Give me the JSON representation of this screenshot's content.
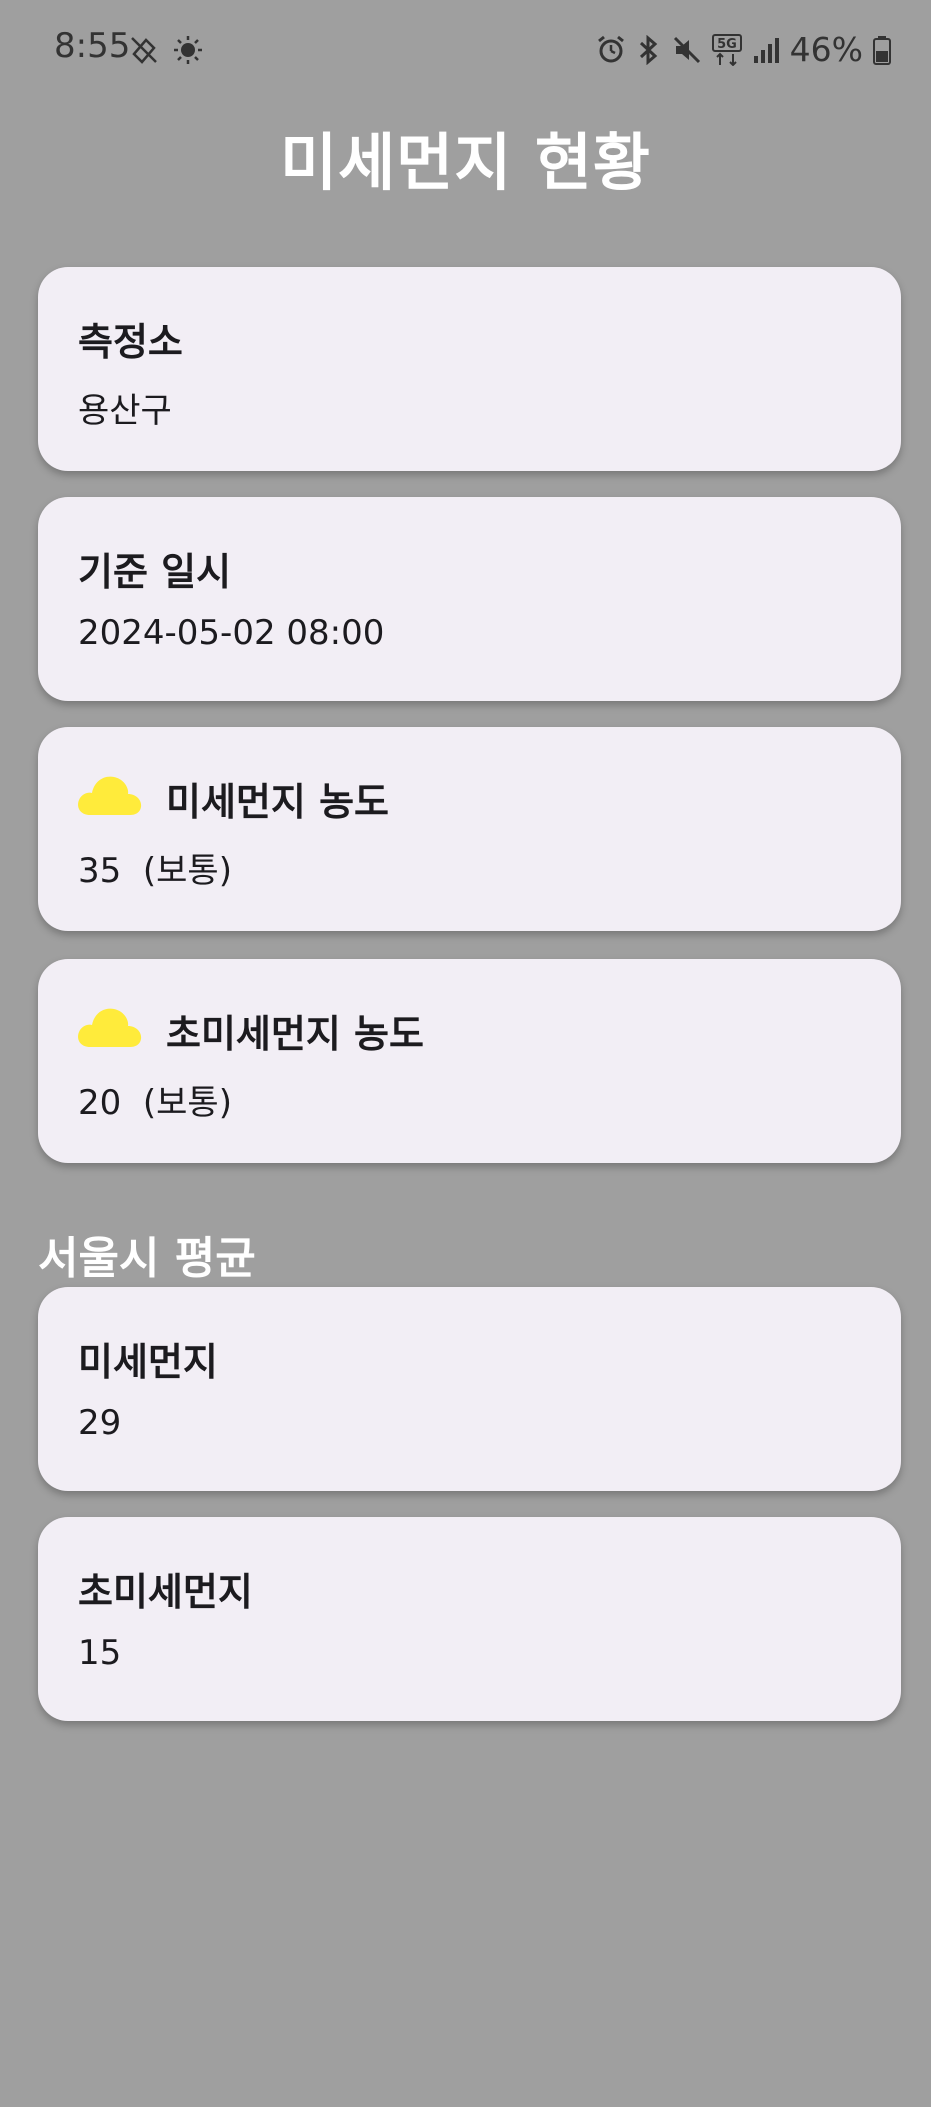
{
  "status_bar": {
    "time": "8:55",
    "battery": "46%",
    "network": "5G"
  },
  "title": "미세먼지 현황",
  "cards": [
    {
      "title": "측정소",
      "value": "용산구"
    },
    {
      "title": "기준 일시",
      "value": "2024-05-02 08:00"
    },
    {
      "title": "미세먼지 농도",
      "value": "35  (보통)",
      "icon": "cloud-icon"
    },
    {
      "title": "초미세먼지 농도",
      "value": "20  (보통)",
      "icon": "cloud-icon"
    }
  ],
  "seoul_section": {
    "heading": "서울시 평균",
    "cards": [
      {
        "title": "미세먼지",
        "value": "29"
      },
      {
        "title": "초미세먼지",
        "value": "15"
      }
    ]
  },
  "colors": {
    "background": "#9f9f9f",
    "card": "#f2eef5",
    "cloud": "#ffeb3b",
    "title_text": "#ffffff"
  }
}
